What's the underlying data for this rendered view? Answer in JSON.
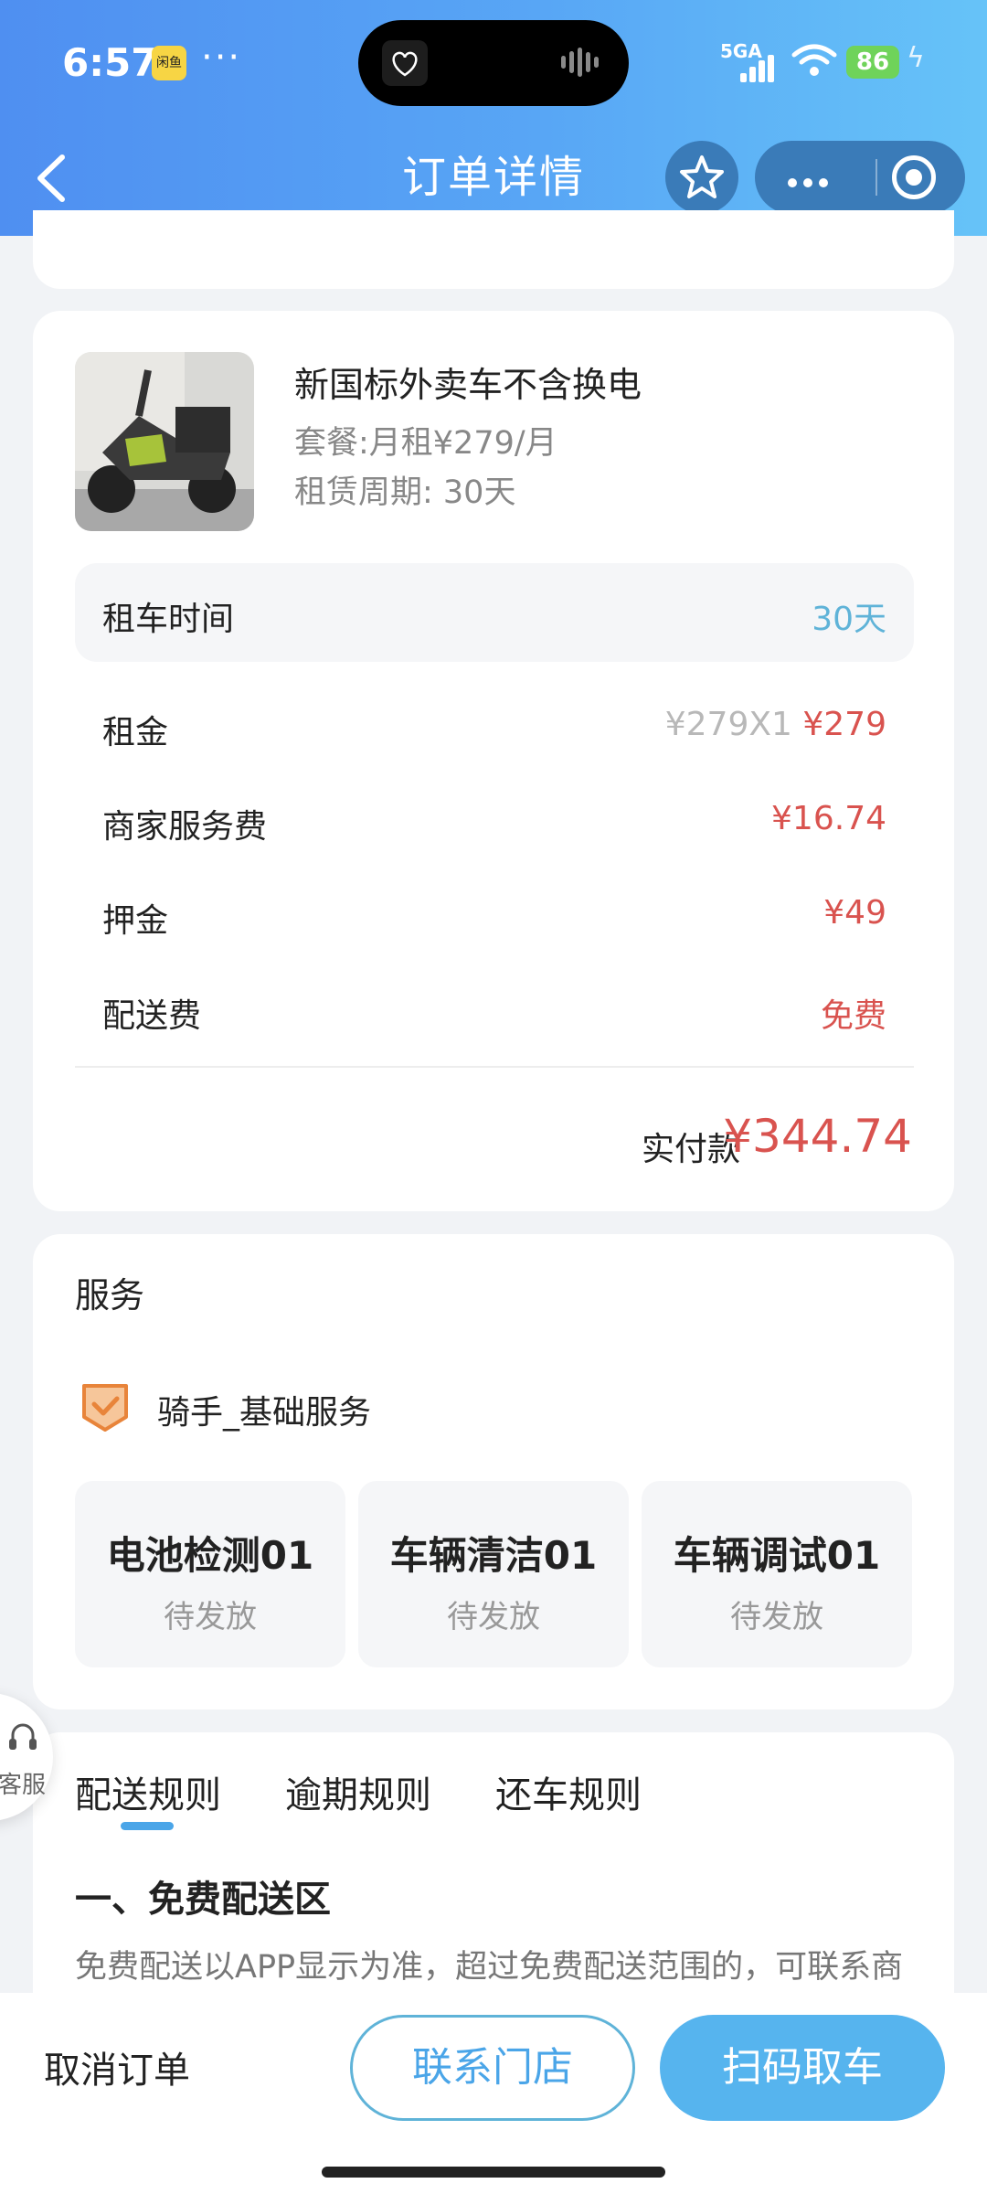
{
  "status_bar": {
    "time": "6:57",
    "app_badge": "闲鱼",
    "more_dots": "···",
    "network": "5GA",
    "battery": "86"
  },
  "nav": {
    "title": "订单详情"
  },
  "order": {
    "product_name": "新国标外卖车不含换电",
    "plan": "套餐:月租¥279/月",
    "period": "租赁周期: 30天",
    "rent_time_label": "租车时间",
    "rent_time_value": "30天",
    "fees": [
      {
        "label": "租金",
        "original": "¥279X1",
        "value": "¥279"
      },
      {
        "label": "商家服务费",
        "value": "¥16.74"
      },
      {
        "label": "押金",
        "value": "¥49"
      },
      {
        "label": "配送费",
        "value": "免费"
      }
    ],
    "total_label": "实付款",
    "total_value": "¥344.74"
  },
  "service": {
    "title": "服务",
    "package_name": "骑手_基础服务",
    "benefits": [
      {
        "name": "电池检测01",
        "status": "待发放"
      },
      {
        "name": "车辆清洁01",
        "status": "待发放"
      },
      {
        "name": "车辆调试01",
        "status": "待发放"
      }
    ]
  },
  "rules": {
    "tabs": [
      "配送规则",
      "逾期规则",
      "还车规则"
    ],
    "active_tab": "配送规则",
    "heading": "一、免费配送区",
    "text": "免费配送以APP显示为准，超过免费配送范围的，可联系商"
  },
  "float_service": {
    "label": "客服"
  },
  "bottom": {
    "cancel": "取消订单",
    "contact": "联系门店",
    "scan": "扫码取车"
  },
  "colors": {
    "accent": "#56b4ee",
    "price_red": "#d9534f",
    "header_start": "#4f8ff1",
    "header_end": "#66c3f8"
  }
}
